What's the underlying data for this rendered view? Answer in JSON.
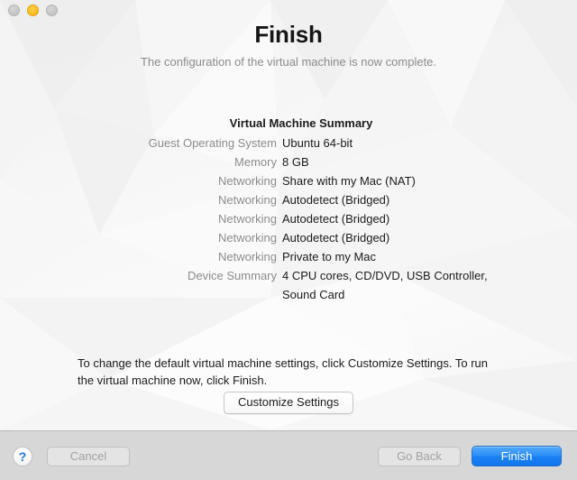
{
  "window": {
    "traffic_lights": [
      {
        "name": "close",
        "color": "#c6c6c6",
        "state": "inactive"
      },
      {
        "name": "minimize",
        "color": "#ffbd24",
        "state": "active"
      },
      {
        "name": "zoom",
        "color": "#c6c6c6",
        "state": "inactive"
      }
    ]
  },
  "header": {
    "title": "Finish",
    "subtitle": "The configuration of the virtual machine is now complete."
  },
  "summary": {
    "title": "Virtual Machine Summary",
    "rows": [
      {
        "label": "Guest Operating System",
        "value": "Ubuntu 64-bit"
      },
      {
        "label": "Memory",
        "value": "8 GB"
      },
      {
        "label": "Networking",
        "value": "Share with my Mac (NAT)"
      },
      {
        "label": "Networking",
        "value": "Autodetect (Bridged)"
      },
      {
        "label": "Networking",
        "value": "Autodetect (Bridged)"
      },
      {
        "label": "Networking",
        "value": "Autodetect (Bridged)"
      },
      {
        "label": "Networking",
        "value": "Private to my Mac"
      },
      {
        "label": "Device Summary",
        "value": "4 CPU cores, CD/DVD, USB Controller, Sound Card"
      }
    ]
  },
  "instructions": {
    "text": "To change the default virtual machine settings, click Customize Settings. To run the virtual machine now, click Finish."
  },
  "customize": {
    "label": "Customize Settings"
  },
  "toolbar": {
    "help_glyph": "?",
    "help_icon": "question-mark-icon",
    "cancel_label": "Cancel",
    "cancel_enabled": false,
    "go_back_label": "Go Back",
    "go_back_enabled": false,
    "finish_label": "Finish",
    "finish_enabled": true,
    "finish_color": "#2c90f8"
  }
}
